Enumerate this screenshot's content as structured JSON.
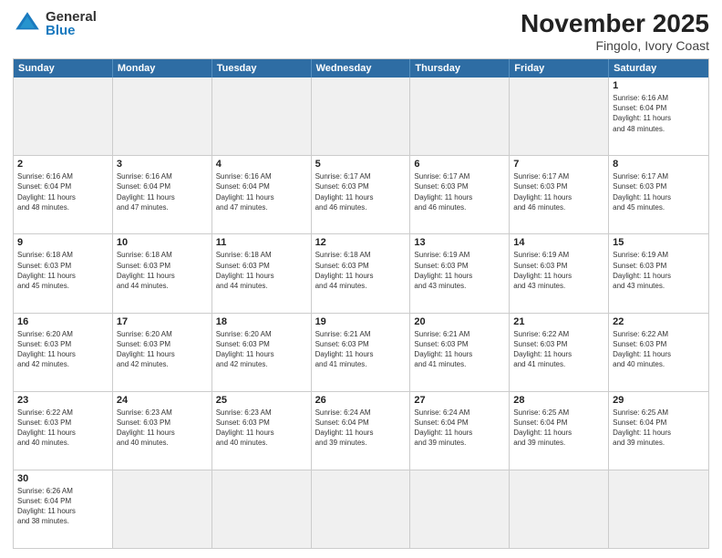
{
  "logo": {
    "general": "General",
    "blue": "Blue"
  },
  "title": "November 2025",
  "subtitle": "Fingolo, Ivory Coast",
  "header_days": [
    "Sunday",
    "Monday",
    "Tuesday",
    "Wednesday",
    "Thursday",
    "Friday",
    "Saturday"
  ],
  "rows": [
    [
      {
        "day": "",
        "empty": true,
        "text": ""
      },
      {
        "day": "",
        "empty": true,
        "text": ""
      },
      {
        "day": "",
        "empty": true,
        "text": ""
      },
      {
        "day": "",
        "empty": true,
        "text": ""
      },
      {
        "day": "",
        "empty": true,
        "text": ""
      },
      {
        "day": "",
        "empty": true,
        "text": ""
      },
      {
        "day": "1",
        "empty": false,
        "text": "Sunrise: 6:16 AM\nSunset: 6:04 PM\nDaylight: 11 hours\nand 48 minutes."
      }
    ],
    [
      {
        "day": "2",
        "empty": false,
        "text": "Sunrise: 6:16 AM\nSunset: 6:04 PM\nDaylight: 11 hours\nand 48 minutes."
      },
      {
        "day": "3",
        "empty": false,
        "text": "Sunrise: 6:16 AM\nSunset: 6:04 PM\nDaylight: 11 hours\nand 47 minutes."
      },
      {
        "day": "4",
        "empty": false,
        "text": "Sunrise: 6:16 AM\nSunset: 6:04 PM\nDaylight: 11 hours\nand 47 minutes."
      },
      {
        "day": "5",
        "empty": false,
        "text": "Sunrise: 6:17 AM\nSunset: 6:03 PM\nDaylight: 11 hours\nand 46 minutes."
      },
      {
        "day": "6",
        "empty": false,
        "text": "Sunrise: 6:17 AM\nSunset: 6:03 PM\nDaylight: 11 hours\nand 46 minutes."
      },
      {
        "day": "7",
        "empty": false,
        "text": "Sunrise: 6:17 AM\nSunset: 6:03 PM\nDaylight: 11 hours\nand 46 minutes."
      },
      {
        "day": "8",
        "empty": false,
        "text": "Sunrise: 6:17 AM\nSunset: 6:03 PM\nDaylight: 11 hours\nand 45 minutes."
      }
    ],
    [
      {
        "day": "9",
        "empty": false,
        "text": "Sunrise: 6:18 AM\nSunset: 6:03 PM\nDaylight: 11 hours\nand 45 minutes."
      },
      {
        "day": "10",
        "empty": false,
        "text": "Sunrise: 6:18 AM\nSunset: 6:03 PM\nDaylight: 11 hours\nand 44 minutes."
      },
      {
        "day": "11",
        "empty": false,
        "text": "Sunrise: 6:18 AM\nSunset: 6:03 PM\nDaylight: 11 hours\nand 44 minutes."
      },
      {
        "day": "12",
        "empty": false,
        "text": "Sunrise: 6:18 AM\nSunset: 6:03 PM\nDaylight: 11 hours\nand 44 minutes."
      },
      {
        "day": "13",
        "empty": false,
        "text": "Sunrise: 6:19 AM\nSunset: 6:03 PM\nDaylight: 11 hours\nand 43 minutes."
      },
      {
        "day": "14",
        "empty": false,
        "text": "Sunrise: 6:19 AM\nSunset: 6:03 PM\nDaylight: 11 hours\nand 43 minutes."
      },
      {
        "day": "15",
        "empty": false,
        "text": "Sunrise: 6:19 AM\nSunset: 6:03 PM\nDaylight: 11 hours\nand 43 minutes."
      }
    ],
    [
      {
        "day": "16",
        "empty": false,
        "text": "Sunrise: 6:20 AM\nSunset: 6:03 PM\nDaylight: 11 hours\nand 42 minutes."
      },
      {
        "day": "17",
        "empty": false,
        "text": "Sunrise: 6:20 AM\nSunset: 6:03 PM\nDaylight: 11 hours\nand 42 minutes."
      },
      {
        "day": "18",
        "empty": false,
        "text": "Sunrise: 6:20 AM\nSunset: 6:03 PM\nDaylight: 11 hours\nand 42 minutes."
      },
      {
        "day": "19",
        "empty": false,
        "text": "Sunrise: 6:21 AM\nSunset: 6:03 PM\nDaylight: 11 hours\nand 41 minutes."
      },
      {
        "day": "20",
        "empty": false,
        "text": "Sunrise: 6:21 AM\nSunset: 6:03 PM\nDaylight: 11 hours\nand 41 minutes."
      },
      {
        "day": "21",
        "empty": false,
        "text": "Sunrise: 6:22 AM\nSunset: 6:03 PM\nDaylight: 11 hours\nand 41 minutes."
      },
      {
        "day": "22",
        "empty": false,
        "text": "Sunrise: 6:22 AM\nSunset: 6:03 PM\nDaylight: 11 hours\nand 40 minutes."
      }
    ],
    [
      {
        "day": "23",
        "empty": false,
        "text": "Sunrise: 6:22 AM\nSunset: 6:03 PM\nDaylight: 11 hours\nand 40 minutes."
      },
      {
        "day": "24",
        "empty": false,
        "text": "Sunrise: 6:23 AM\nSunset: 6:03 PM\nDaylight: 11 hours\nand 40 minutes."
      },
      {
        "day": "25",
        "empty": false,
        "text": "Sunrise: 6:23 AM\nSunset: 6:03 PM\nDaylight: 11 hours\nand 40 minutes."
      },
      {
        "day": "26",
        "empty": false,
        "text": "Sunrise: 6:24 AM\nSunset: 6:04 PM\nDaylight: 11 hours\nand 39 minutes."
      },
      {
        "day": "27",
        "empty": false,
        "text": "Sunrise: 6:24 AM\nSunset: 6:04 PM\nDaylight: 11 hours\nand 39 minutes."
      },
      {
        "day": "28",
        "empty": false,
        "text": "Sunrise: 6:25 AM\nSunset: 6:04 PM\nDaylight: 11 hours\nand 39 minutes."
      },
      {
        "day": "29",
        "empty": false,
        "text": "Sunrise: 6:25 AM\nSunset: 6:04 PM\nDaylight: 11 hours\nand 39 minutes."
      }
    ],
    [
      {
        "day": "30",
        "empty": false,
        "text": "Sunrise: 6:26 AM\nSunset: 6:04 PM\nDaylight: 11 hours\nand 38 minutes."
      },
      {
        "day": "",
        "empty": true,
        "text": ""
      },
      {
        "day": "",
        "empty": true,
        "text": ""
      },
      {
        "day": "",
        "empty": true,
        "text": ""
      },
      {
        "day": "",
        "empty": true,
        "text": ""
      },
      {
        "day": "",
        "empty": true,
        "text": ""
      },
      {
        "day": "",
        "empty": true,
        "text": ""
      }
    ]
  ]
}
